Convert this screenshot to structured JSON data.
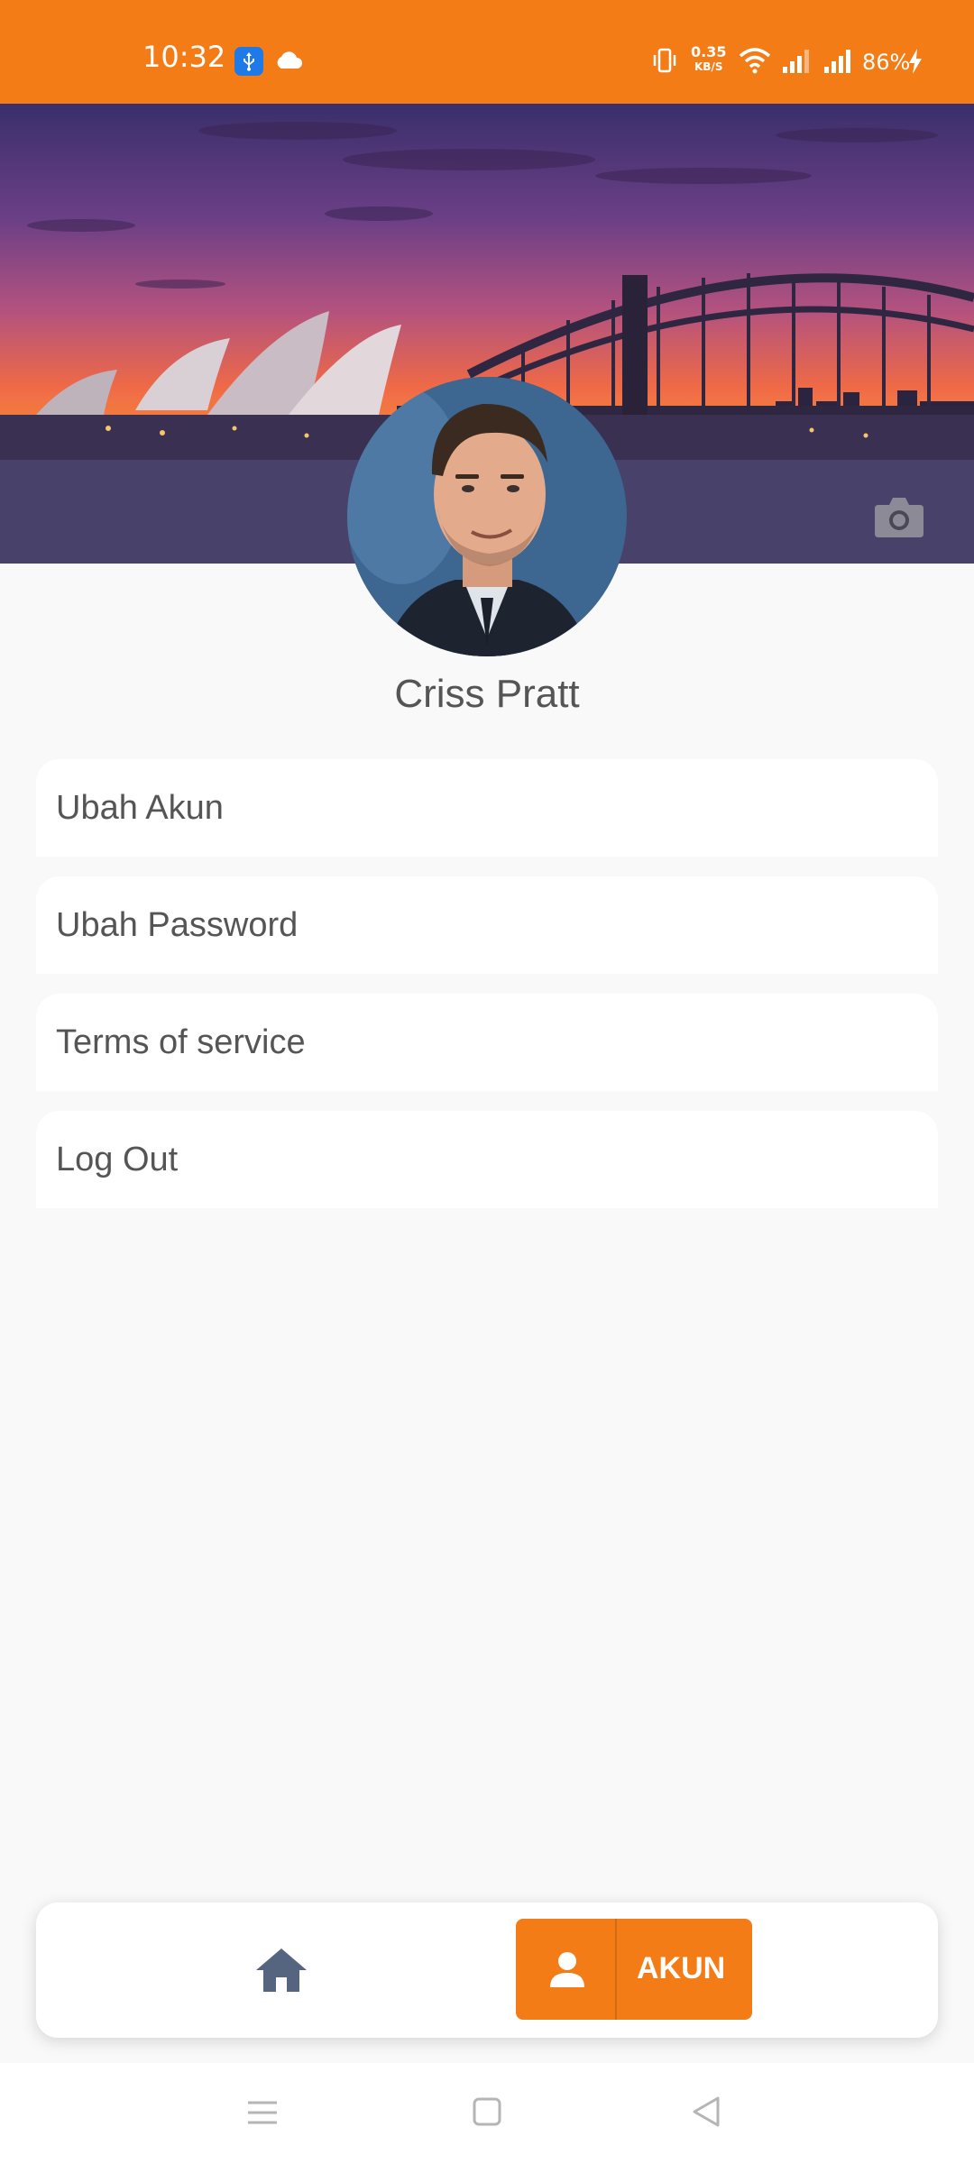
{
  "status_bar": {
    "time": "10:32",
    "speed_top": "0.35",
    "speed_bottom": "KB/S",
    "battery": "86%"
  },
  "profile": {
    "name": "Criss Pratt"
  },
  "menu": {
    "items": [
      {
        "label": "Ubah Akun"
      },
      {
        "label": "Ubah Password"
      },
      {
        "label": "Terms of service"
      },
      {
        "label": "Log Out"
      }
    ]
  },
  "bottom_nav": {
    "akun_label": "AKUN"
  },
  "colors": {
    "accent": "#f47c16",
    "background": "#f9f9f9"
  }
}
